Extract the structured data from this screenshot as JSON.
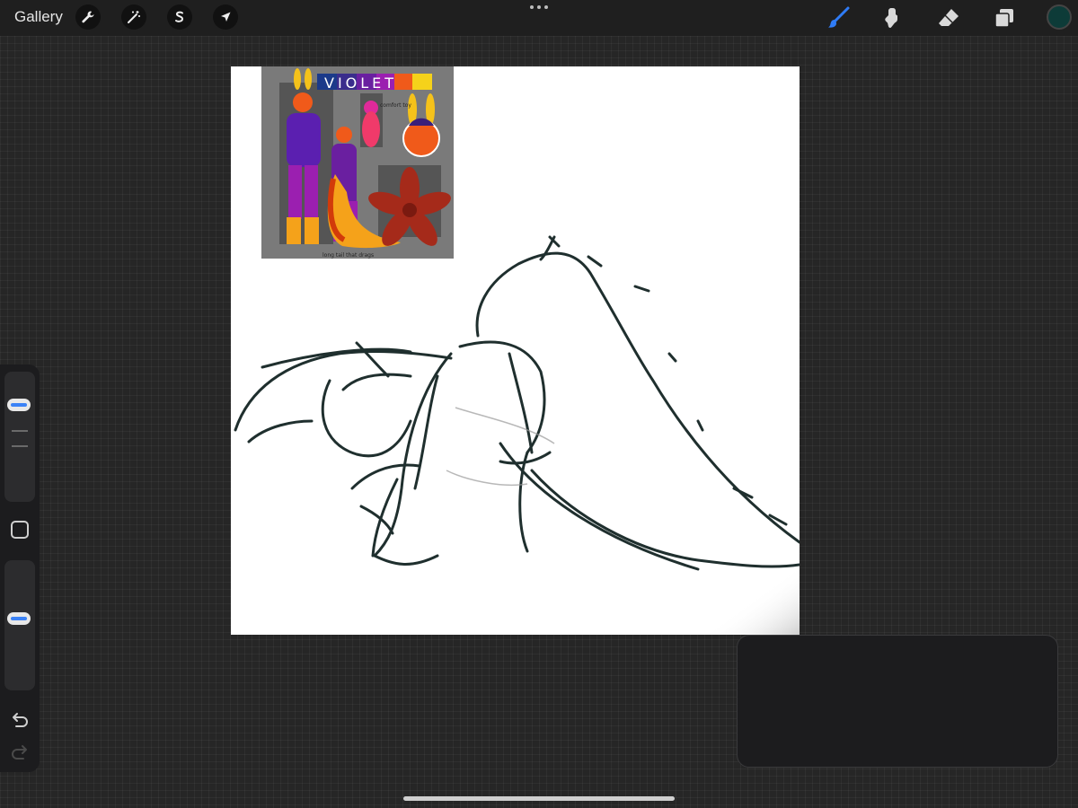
{
  "topbar": {
    "gallery_label": "Gallery",
    "left_tools": [
      {
        "name": "actions",
        "icon": "wrench-icon"
      },
      {
        "name": "adjustments",
        "icon": "magic-wand-icon"
      },
      {
        "name": "selection",
        "icon": "selection-s-icon"
      },
      {
        "name": "transform",
        "icon": "arrow-cursor-icon"
      }
    ],
    "right_tools": [
      {
        "name": "brush",
        "icon": "brush-icon",
        "active": true
      },
      {
        "name": "smudge",
        "icon": "smudge-icon"
      },
      {
        "name": "eraser",
        "icon": "eraser-icon"
      },
      {
        "name": "layers",
        "icon": "layers-icon"
      }
    ],
    "current_color": "#0d3b38"
  },
  "canvas": {
    "background": "#ffffff",
    "stroke_color": "#1f2f2e",
    "reference": {
      "title_text": "VIOLET",
      "palette": [
        "#1b3a8a",
        "#3a2d8c",
        "#6a1fa0",
        "#9b1fb0",
        "#f05a1a",
        "#f5d21a"
      ],
      "notes": [
        "comfort toy",
        "long tail that drags"
      ]
    }
  },
  "sidebar": {
    "brush_size_level": 0.15,
    "opacity_level": 0.45
  },
  "accent": "#3b82f6"
}
